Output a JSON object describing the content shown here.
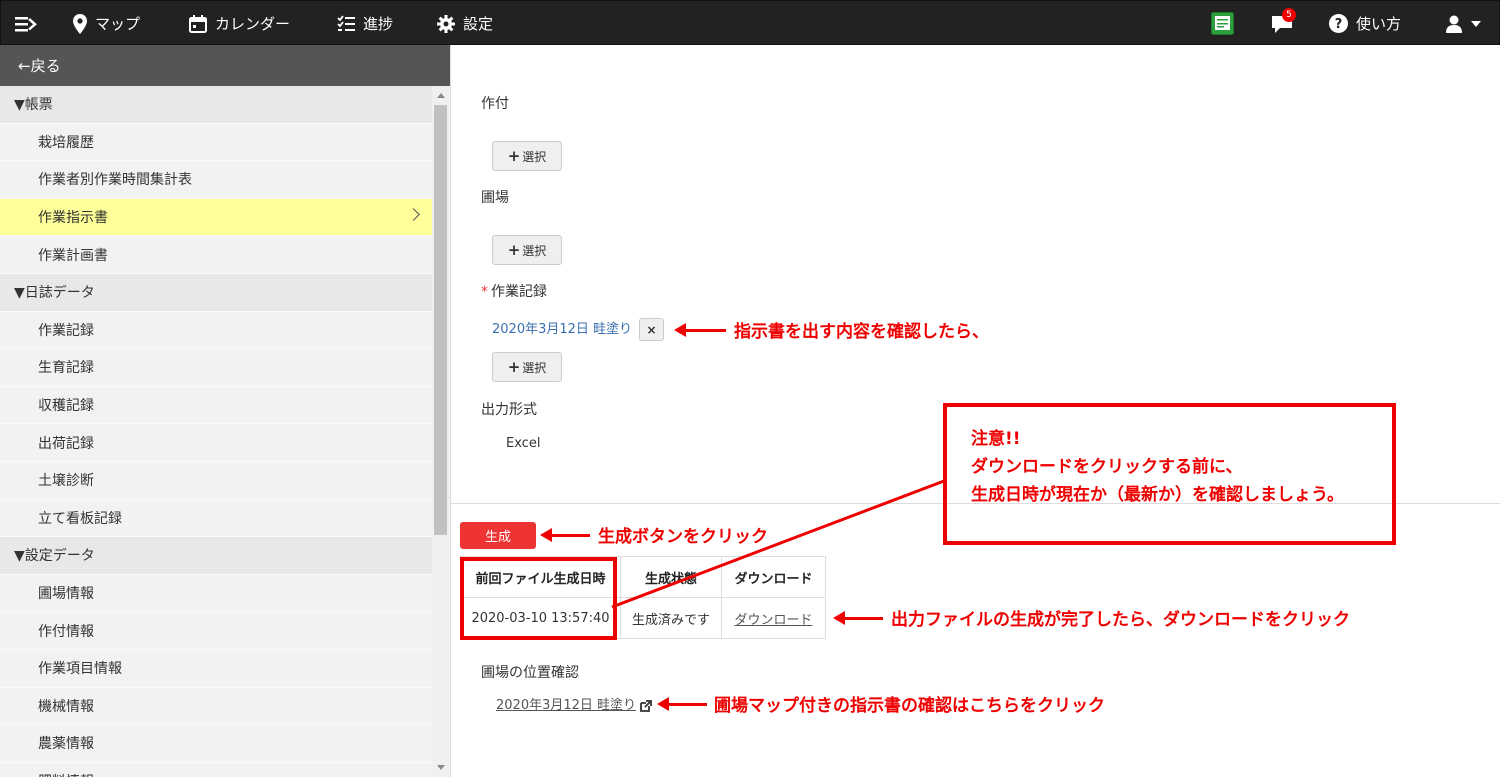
{
  "nav": {
    "map_label": "マップ",
    "calendar_label": "カレンダー",
    "progress_label": "進捗",
    "settings_label": "設定",
    "notification_count": "5",
    "help_label": "使い方"
  },
  "sidebar": {
    "back_label": "←戻る",
    "rows": [
      {
        "type": "section",
        "label": "▼帳票"
      },
      {
        "type": "item",
        "label": "栽培履歴"
      },
      {
        "type": "item",
        "label": "作業者別作業時間集計表"
      },
      {
        "type": "item",
        "label": "作業指示書",
        "active": true
      },
      {
        "type": "item",
        "label": "作業計画書"
      },
      {
        "type": "section",
        "label": "▼日誌データ"
      },
      {
        "type": "item",
        "label": "作業記録"
      },
      {
        "type": "item",
        "label": "生育記録"
      },
      {
        "type": "item",
        "label": "収穫記録"
      },
      {
        "type": "item",
        "label": "出荷記録"
      },
      {
        "type": "item",
        "label": "土壌診断"
      },
      {
        "type": "item",
        "label": "立て看板記録"
      },
      {
        "type": "section",
        "label": "▼設定データ"
      },
      {
        "type": "item",
        "label": "圃場情報"
      },
      {
        "type": "item",
        "label": "作付情報"
      },
      {
        "type": "item",
        "label": "作業項目情報"
      },
      {
        "type": "item",
        "label": "機械情報"
      },
      {
        "type": "item",
        "label": "農薬情報"
      },
      {
        "type": "item",
        "label": "肥料情報"
      }
    ]
  },
  "form": {
    "crop_label": "作付",
    "field_label": "圃場",
    "required_mark": "*",
    "work_record_label": "作業記録",
    "selected_record": "2020年3月12日 畦塗り",
    "remove_label": "×",
    "select_label": "選択",
    "output_format_label": "出力形式",
    "output_format_value": "Excel"
  },
  "generate": {
    "button_label": "生成",
    "table": {
      "headers": [
        "前回ファイル生成日時",
        "生成状態",
        "ダウンロード"
      ],
      "row": [
        "2020-03-10 13:57:40",
        "生成済みです",
        "ダウンロード"
      ]
    }
  },
  "location": {
    "label": "圃場の位置確認",
    "link": "2020年3月12日 畦塗り"
  },
  "annotations": {
    "confirm_content": "指示書を出す内容を確認したら、",
    "click_generate": "生成ボタンをクリック",
    "click_download": "出力ファイルの生成が完了したら、ダウンロードをクリック",
    "click_map": "圃場マップ付きの指示書の確認はこちらをクリック",
    "note_title": "注意!!",
    "note_line1": "ダウンロードをクリックする前に、",
    "note_line2": "生成日時が現在か（最新か）を確認しましょう。"
  },
  "colors": {
    "annotation": "#ee0000",
    "active_row": "#ffff99",
    "generate_button": "#ee3333"
  }
}
